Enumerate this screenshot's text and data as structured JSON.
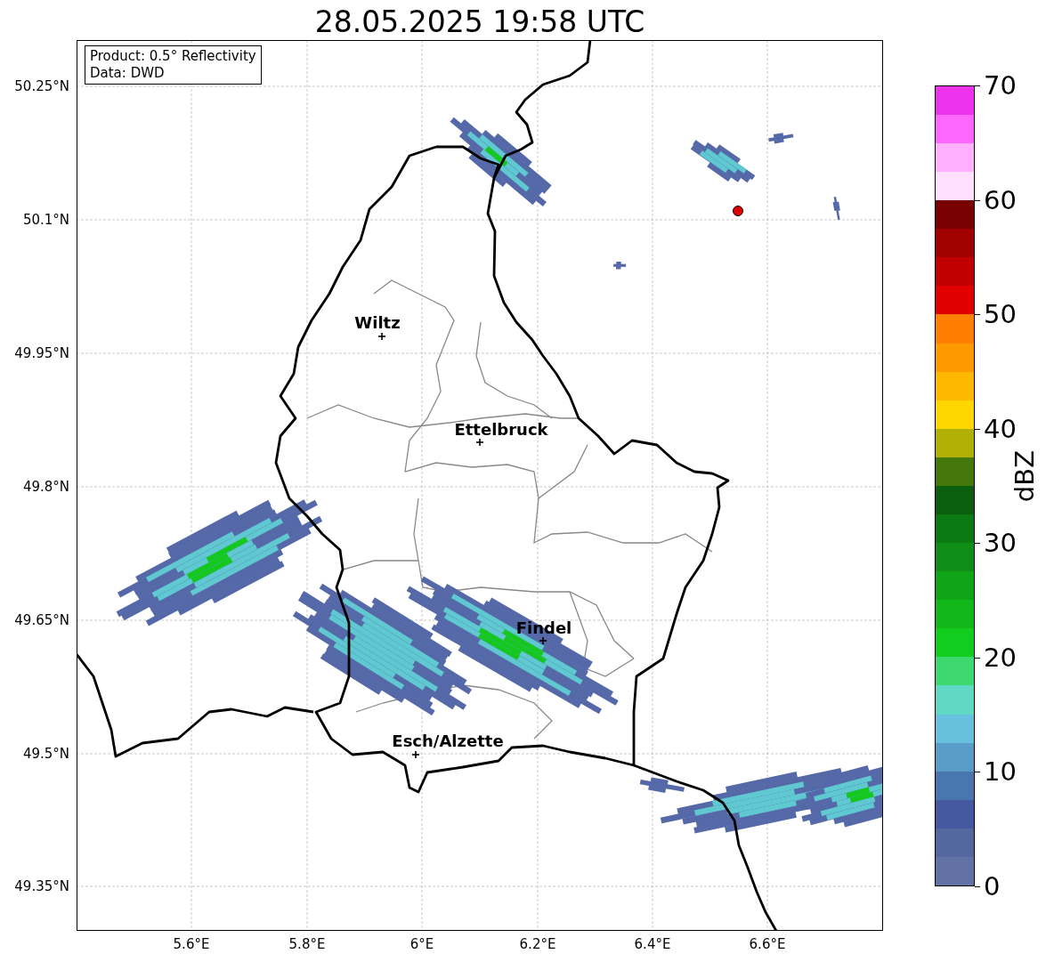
{
  "title": "28.05.2025 19:58 UTC",
  "info_box": {
    "lines": [
      "Product: 0.5° Reflectivity",
      "Data: DWD"
    ]
  },
  "y_ticks": [
    "50.25°N",
    "50.1°N",
    "49.95°N",
    "49.8°N",
    "49.65°N",
    "49.5°N",
    "49.35°N"
  ],
  "x_ticks": [
    "5.6°E",
    "5.8°E",
    "6°E",
    "6.2°E",
    "6.4°E",
    "6.6°E"
  ],
  "cities": [
    {
      "name": "Wiltz"
    },
    {
      "name": "Ettelbruck"
    },
    {
      "name": "Findel"
    },
    {
      "name": "Esch/Alzette"
    }
  ],
  "colorbar": {
    "label": "dBZ",
    "ticks": [
      "70",
      "60",
      "50",
      "40",
      "30",
      "20",
      "10",
      "0"
    ],
    "bands": [
      {
        "color": "#6272a4"
      },
      {
        "color": "#55679f"
      },
      {
        "color": "#4459a0"
      },
      {
        "color": "#4a76b0"
      },
      {
        "color": "#5a9cc8"
      },
      {
        "color": "#66c0de"
      },
      {
        "color": "#5fd8c4"
      },
      {
        "color": "#3dd870"
      },
      {
        "color": "#12cc1e"
      },
      {
        "color": "#12b81a"
      },
      {
        "color": "#10a417"
      },
      {
        "color": "#0e8e16"
      },
      {
        "color": "#0c7a12"
      },
      {
        "color": "#0a5e0e"
      },
      {
        "color": "#44780a"
      },
      {
        "color": "#b0b005"
      },
      {
        "color": "#ffd700"
      },
      {
        "color": "#ffb800"
      },
      {
        "color": "#ff9900"
      },
      {
        "color": "#ff7f00"
      },
      {
        "color": "#e00000"
      },
      {
        "color": "#c00000"
      },
      {
        "color": "#a00000"
      },
      {
        "color": "#780000"
      },
      {
        "color": "#ffe0ff"
      },
      {
        "color": "#ffb0ff"
      },
      {
        "color": "#ff66ff"
      },
      {
        "color": "#ee33ee"
      }
    ]
  }
}
